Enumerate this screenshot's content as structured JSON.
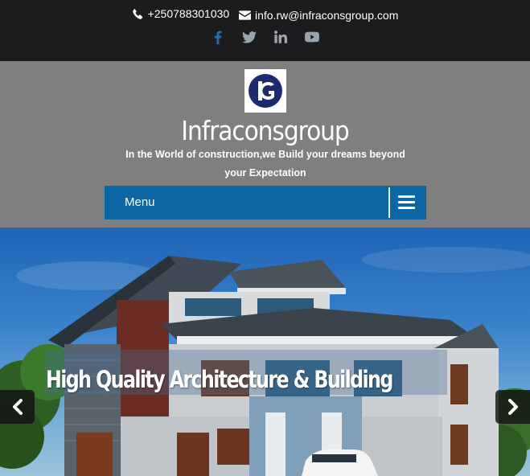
{
  "topbar": {
    "phone": "+250788301030",
    "email": "info.rw@infraconsgroup.com",
    "social": [
      {
        "icon": "facebook-icon",
        "color": "#1f6db0"
      },
      {
        "icon": "twitter-icon",
        "color": "#9aa4ad"
      },
      {
        "icon": "linkedin-icon",
        "color": "#9aa4ad"
      },
      {
        "icon": "youtube-icon",
        "color": "#9aa4ad"
      }
    ]
  },
  "header": {
    "logo_text": "IG",
    "site_title": "Infraconsgroup",
    "tagline": "In the World of construction,we Build your dreams beyond your Expectation"
  },
  "menu": {
    "label": "Menu",
    "toggle_icon": "hamburger-icon",
    "bar_color": "#0c66a3"
  },
  "slider": {
    "caption": "High Quality Architecture & Building",
    "prev_icon": "chevron-left-icon",
    "next_icon": "chevron-right-icon"
  },
  "colors": {
    "topbar_bg": "#1c1c1e",
    "header_bg": "#7f7f7f",
    "logo_navy": "#1d2b6e"
  }
}
